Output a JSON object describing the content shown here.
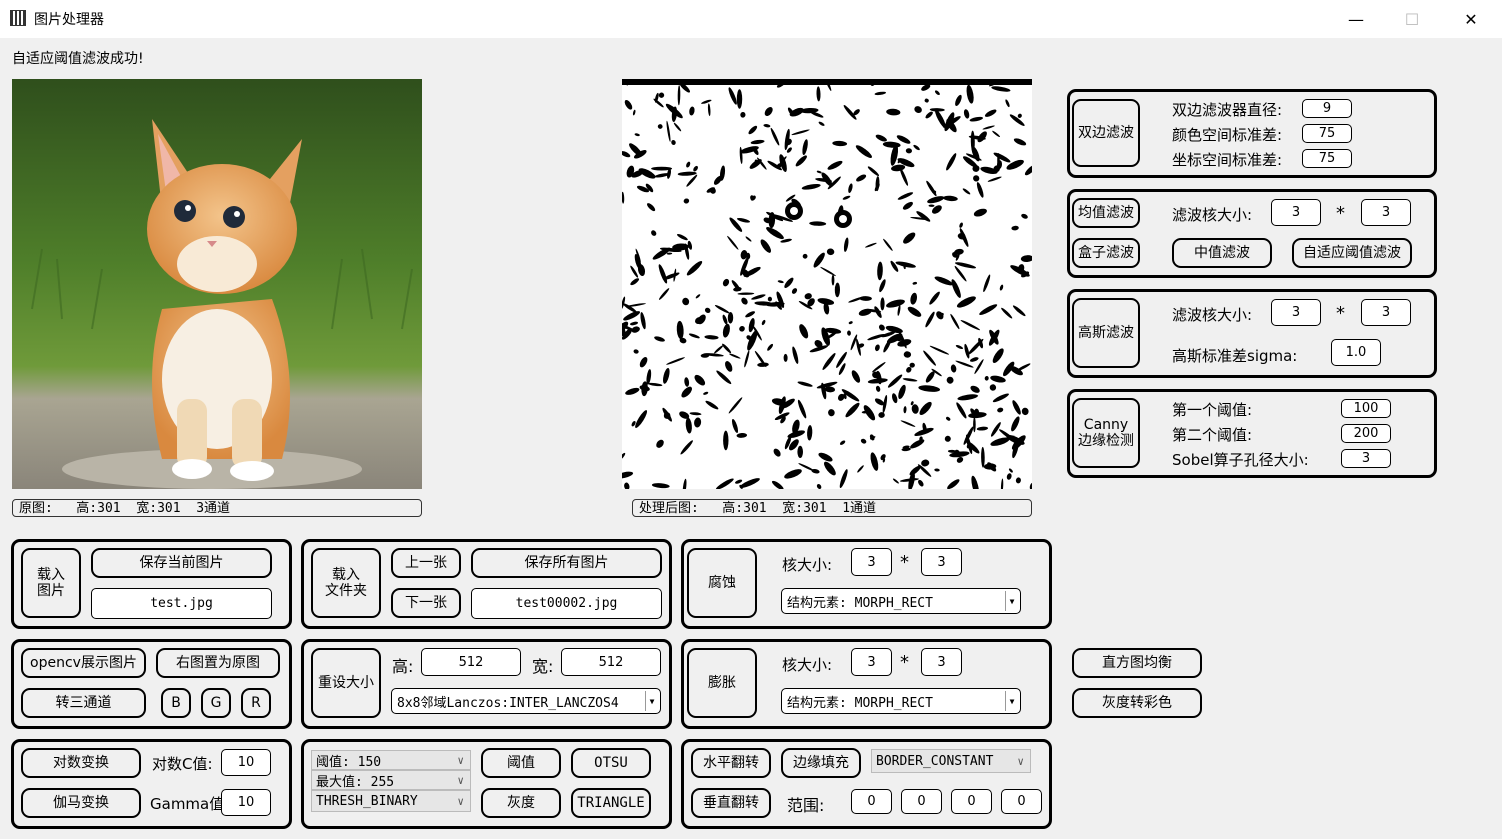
{
  "window": {
    "title": "图片处理器",
    "minimize_icon": "minimize-icon",
    "maximize_icon": "maximize-icon",
    "close_icon": "close-icon"
  },
  "status_text": "自适应阈值滤波成功!",
  "original": {
    "label": "原图:   高:301  宽:301  3通道"
  },
  "processed": {
    "label": "处理后图:   高:301  宽:301  1通道"
  },
  "bilateral": {
    "button": "双边滤波",
    "diameter_label": "双边滤波器直径:",
    "diameter": "9",
    "color_sigma_label": "颜色空间标准差:",
    "color_sigma": "75",
    "space_sigma_label": "坐标空间标准差:",
    "space_sigma": "75"
  },
  "mean_filter": {
    "button": "均值滤波",
    "kernel_label": "滤波核大小:",
    "k1": "3",
    "times": "*",
    "k2": "3",
    "box_button": "盒子滤波",
    "median_button": "中值滤波",
    "adaptive_button": "自适应阈值滤波"
  },
  "gaussian": {
    "button": "高斯滤波",
    "kernel_label": "滤波核大小:",
    "k1": "3",
    "times": "*",
    "k2": "3",
    "sigma_label": "高斯标准差sigma:",
    "sigma": "1.0"
  },
  "canny": {
    "button": "Canny\n边缘检测",
    "t1_label": "第一个阈值:",
    "t1": "100",
    "t2_label": "第二个阈值:",
    "t2": "200",
    "sobel_label": "Sobel算子孔径大小:",
    "sobel": "3"
  },
  "load_image": {
    "button": "载入\n图片",
    "save_button": "保存当前图片",
    "filename": "test.jpg"
  },
  "load_folder": {
    "button": "载入\n文件夹",
    "prev_button": "上一张",
    "next_button": "下一张",
    "save_all_button": "保存所有图片",
    "filename": "test00002.jpg"
  },
  "erode": {
    "button": "腐蚀",
    "kernel_label": "核大小:",
    "k1": "3",
    "times": "*",
    "k2": "3",
    "element": "结构元素: MORPH_RECT"
  },
  "dilate": {
    "button": "膨胀",
    "kernel_label": "核大小:",
    "k1": "3",
    "times": "*",
    "k2": "3",
    "element": "结构元素: MORPH_RECT"
  },
  "display": {
    "opencv_button": "opencv展示图片",
    "set_original_button": "右图置为原图",
    "three_channel_button": "转三通道",
    "b_button": "B",
    "g_button": "G",
    "r_button": "R"
  },
  "resize": {
    "button": "重设大小",
    "h_label": "高:",
    "h": "512",
    "w_label": "宽:",
    "w": "512",
    "interp": "8x8邻域Lanczos:INTER_LANCZOS4"
  },
  "hist_button": "直方图均衡",
  "gray2color_button": "灰度转彩色",
  "transform": {
    "log_button": "对数变换",
    "log_c_label": "对数C值:",
    "log_c": "10",
    "gamma_button": "伽马变换",
    "gamma_label": "Gamma值:",
    "gamma": "10"
  },
  "threshold": {
    "thresh_select": "阈值: 150",
    "max_select": "最大值: 255",
    "type_select": "THRESH_BINARY",
    "thresh_button": "阈值",
    "otsu_button": "OTSU",
    "gray_button": "灰度",
    "triangle_button": "TRIANGLE"
  },
  "geometry": {
    "hflip_button": "水平翻转",
    "border_button": "边缘填充",
    "border_select": "BORDER_CONSTANT",
    "vflip_button": "垂直翻转",
    "range_label": "范围:",
    "r1": "0",
    "r2": "0",
    "r3": "0",
    "r4": "0"
  }
}
